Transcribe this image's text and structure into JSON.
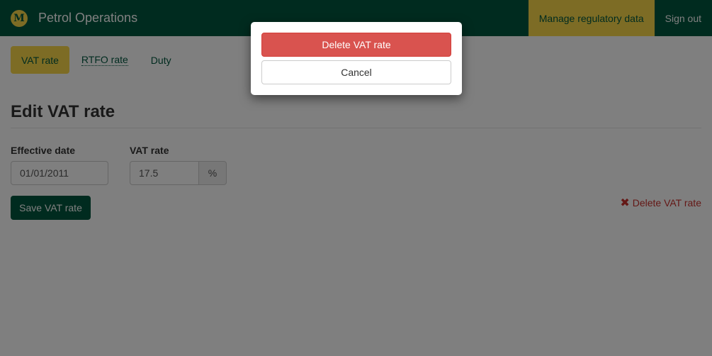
{
  "navbar": {
    "logo_letter": "M",
    "title": "Petrol Operations",
    "links": [
      {
        "label": "Manage regulatory data",
        "active": true
      },
      {
        "label": "Sign out",
        "active": false
      }
    ]
  },
  "tabs": [
    {
      "label": "VAT rate",
      "active": true
    },
    {
      "label": "RTFO rate",
      "active": false
    },
    {
      "label": "Duty",
      "active": false
    }
  ],
  "page": {
    "title": "Edit VAT rate"
  },
  "form": {
    "effective_date_label": "Effective date",
    "effective_date_value": "01/01/2011",
    "vat_rate_label": "VAT rate",
    "vat_rate_value": "17.5",
    "vat_rate_unit": "%",
    "save_label": "Save VAT rate",
    "delete_label": "Delete VAT rate",
    "delete_icon": "✖"
  },
  "modal": {
    "confirm_label": "Delete VAT rate",
    "cancel_label": "Cancel"
  },
  "colors": {
    "brand_green": "#00573f",
    "brand_yellow": "#fbd94a",
    "danger": "#d9534f"
  }
}
